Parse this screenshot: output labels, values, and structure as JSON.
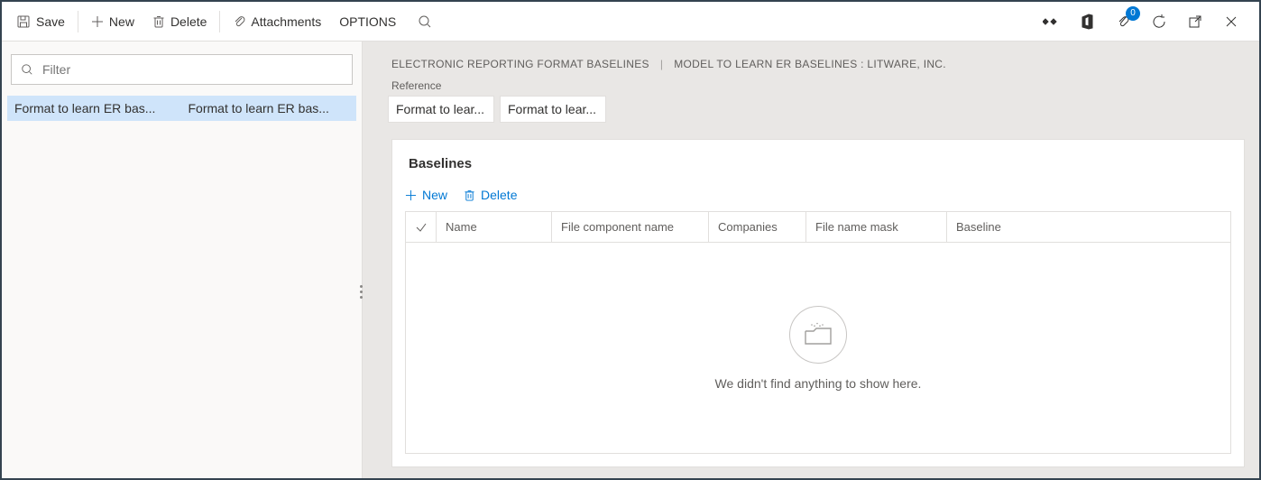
{
  "toolbar": {
    "save": "Save",
    "new": "New",
    "delete": "Delete",
    "attachments": "Attachments",
    "options": "OPTIONS"
  },
  "header_icons": {
    "attachment_badge": "0"
  },
  "left": {
    "filter_placeholder": "Filter",
    "rows": [
      {
        "c1": "Format to learn ER bas...",
        "c2": "Format to learn ER bas..."
      }
    ]
  },
  "breadcrumb": {
    "a": "ELECTRONIC REPORTING FORMAT BASELINES",
    "b": "MODEL TO LEARN ER BASELINES : LITWARE, INC."
  },
  "reference": {
    "label": "Reference",
    "c1": "Format to lear...",
    "c2": "Format to lear..."
  },
  "baselines": {
    "title": "Baselines",
    "new": "New",
    "delete": "Delete",
    "columns": {
      "name": "Name",
      "comp": "File component name",
      "co": "Companies",
      "mask": "File name mask",
      "base": "Baseline"
    },
    "empty": "We didn't find anything to show here."
  }
}
